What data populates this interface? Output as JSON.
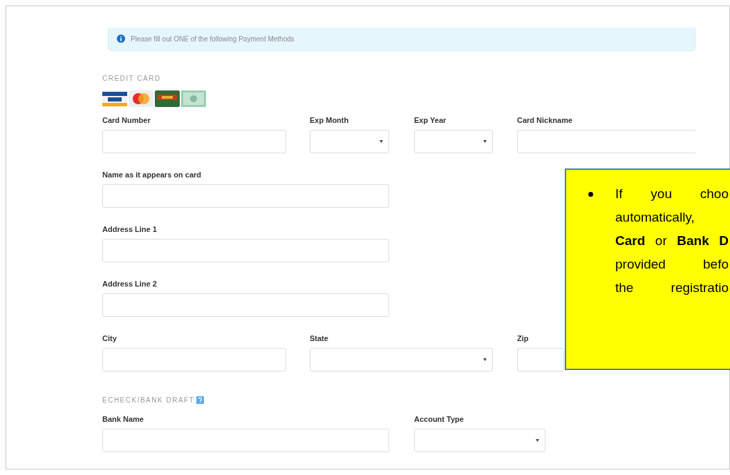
{
  "notice": {
    "text": "Please fill out ONE of the following Payment Methods"
  },
  "credit_card": {
    "heading": "CREDIT CARD",
    "fields": [
      {
        "label": "Card Number",
        "kind": "text"
      },
      {
        "label": "Exp Month",
        "kind": "select"
      },
      {
        "label": "Exp Year",
        "kind": "select"
      },
      {
        "label": "Card Nickname",
        "kind": "text"
      },
      {
        "label": "Name as it appears on card",
        "kind": "text"
      },
      {
        "label": "Address Line 1",
        "kind": "text"
      },
      {
        "label": "Address Line 2",
        "kind": "text"
      },
      {
        "label": "City",
        "kind": "text"
      },
      {
        "label": "State",
        "kind": "select"
      },
      {
        "label": "Zip",
        "kind": "text"
      }
    ]
  },
  "echeck": {
    "heading": "ECHECK/BANK DRAFT",
    "fields": [
      {
        "label": "Bank Name",
        "kind": "text"
      },
      {
        "label": "Account Type",
        "kind": "select"
      }
    ]
  },
  "callout": {
    "lines": [
      "If you choo",
      "automatically,",
      "**Card** or **Bank D**",
      "provided befo",
      "the registratio"
    ]
  }
}
